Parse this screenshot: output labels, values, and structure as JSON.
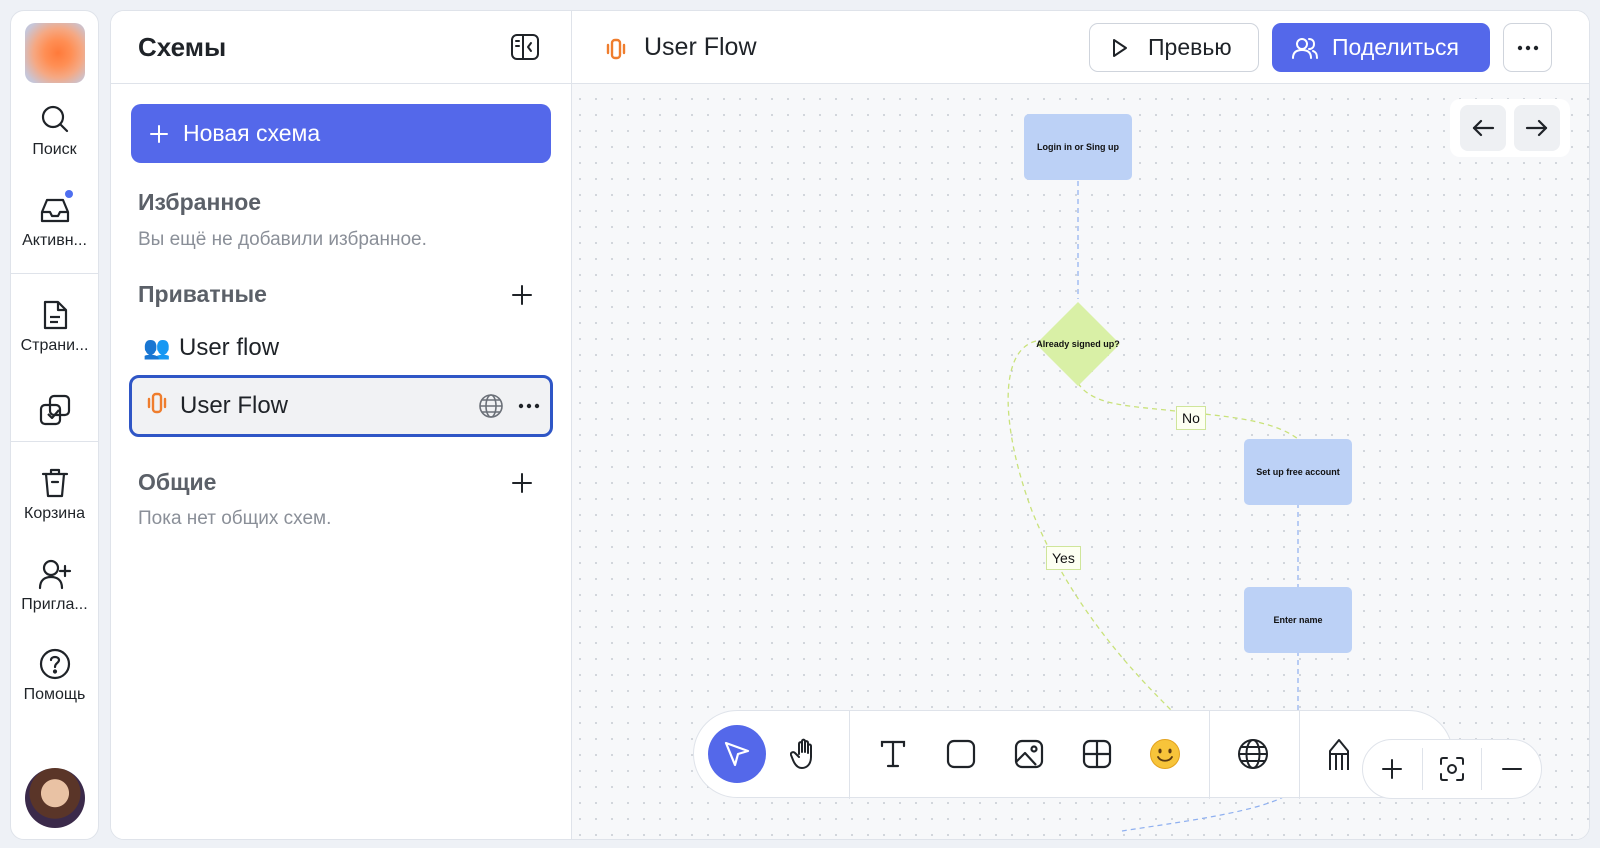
{
  "rail": {
    "items": [
      {
        "label": "Поиск",
        "icon": "search-icon"
      },
      {
        "label": "Активн...",
        "icon": "inbox-icon"
      },
      {
        "label": "Страни...",
        "icon": "page-icon"
      },
      {
        "label": "",
        "icon": "shapes-icon"
      },
      {
        "label": "Корзина",
        "icon": "trash-icon"
      },
      {
        "label": "Пригла...",
        "icon": "add-user-icon"
      },
      {
        "label": "Помощь",
        "icon": "help-icon"
      }
    ]
  },
  "sidebar": {
    "title": "Схемы",
    "new_button": "Новая схема",
    "favorites": {
      "title": "Избранное",
      "empty": "Вы ещё не добавили избранное."
    },
    "private": {
      "title": "Приватные",
      "items": [
        {
          "label": "User flow",
          "icon": "👥"
        },
        {
          "label": "User Flow",
          "icon": "flow-icon",
          "selected": true
        }
      ]
    },
    "shared": {
      "title": "Общие",
      "empty": "Пока нет общих схем."
    }
  },
  "header": {
    "doc_title": "User Flow",
    "preview": "Превью",
    "share": "Поделиться"
  },
  "diagram": {
    "nodes": [
      {
        "id": "login",
        "label": "Login in or Sing up"
      },
      {
        "id": "decision",
        "label": "Already signed up?"
      },
      {
        "id": "setup",
        "label": "Set up free account"
      },
      {
        "id": "name",
        "label": "Enter name"
      }
    ],
    "edge_labels": {
      "no": "No",
      "yes": "Yes"
    }
  },
  "colors": {
    "accent": "#5468ea",
    "node_blue": "#bcd1f6",
    "decision_green": "#d9f0a6",
    "selection_border": "#2f56c6",
    "flow_orange": "#ef7d2d"
  }
}
